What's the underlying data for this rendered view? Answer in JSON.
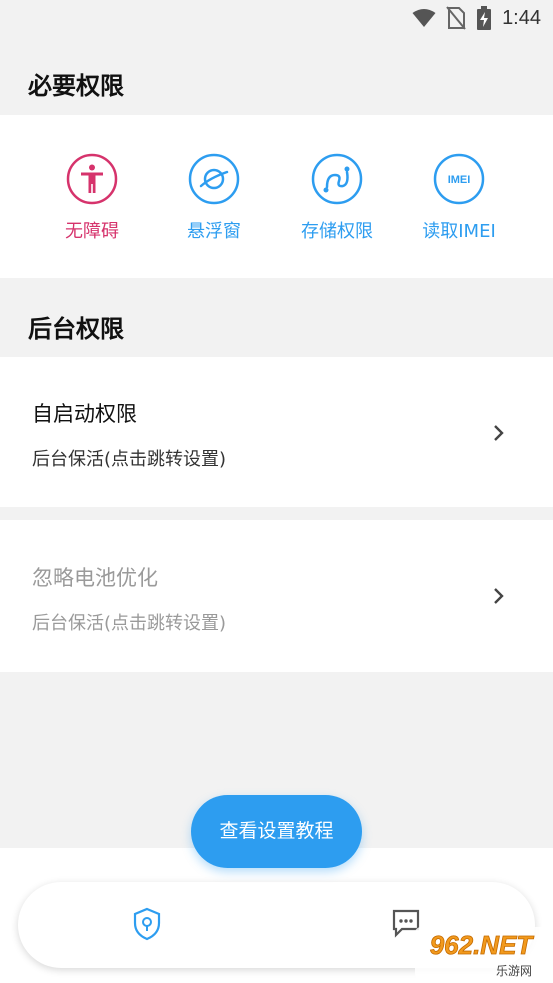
{
  "status_bar": {
    "time": "1:44"
  },
  "required": {
    "title": "必要权限",
    "items": [
      {
        "label": "无障碍",
        "color": "#d6336c",
        "icon": "accessibility-icon"
      },
      {
        "label": "悬浮窗",
        "color": "#2d9df0",
        "icon": "floating-window-icon"
      },
      {
        "label": "存储权限",
        "color": "#2d9df0",
        "icon": "storage-icon"
      },
      {
        "label": "读取IMEI",
        "color": "#2d9df0",
        "icon": "imei-icon",
        "icon_text": "IMEI"
      }
    ]
  },
  "background": {
    "title": "后台权限",
    "rows": [
      {
        "title": "自启动权限",
        "subtitle": "后台保活(点击跳转设置)",
        "enabled": true
      },
      {
        "title": "忽略电池优化",
        "subtitle": "后台保活(点击跳转设置)",
        "enabled": false
      }
    ]
  },
  "fab": {
    "label": "查看设置教程"
  },
  "bottom_nav": {
    "items": [
      {
        "icon": "shield-location-icon"
      },
      {
        "icon": "message-icon"
      }
    ]
  },
  "watermark": {
    "text": "962.NET",
    "subtext": "乐游网"
  },
  "colors": {
    "accent": "#2d9df0",
    "pink": "#d6336c",
    "disabled": "#9a9a9a"
  }
}
